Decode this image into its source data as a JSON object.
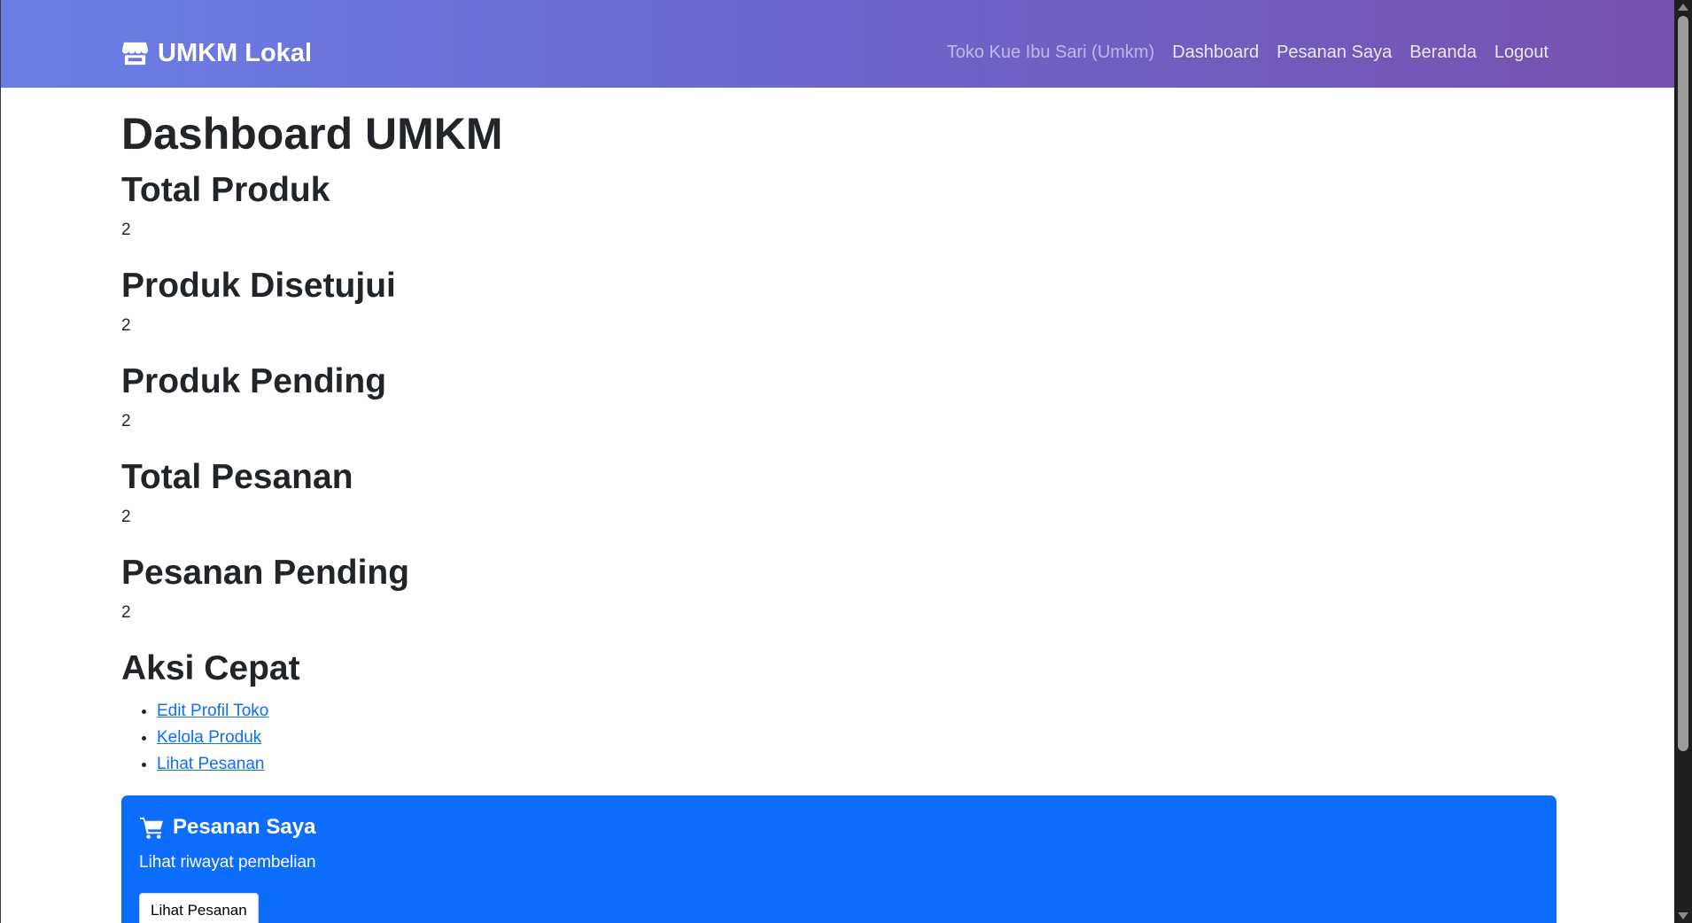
{
  "navbar": {
    "brand": "UMKM Lokal",
    "brand_icon": "store-icon",
    "user_label": "Toko Kue Ibu Sari (Umkm)",
    "links": [
      "Dashboard",
      "Pesanan Saya",
      "Beranda",
      "Logout"
    ],
    "gradient": [
      "#6a7fe6",
      "#7651ae"
    ]
  },
  "page": {
    "title": "Dashboard UMKM"
  },
  "stats": [
    {
      "label": "Total Produk",
      "value": "2"
    },
    {
      "label": "Produk Disetujui",
      "value": "2"
    },
    {
      "label": "Produk Pending",
      "value": "2"
    },
    {
      "label": "Total Pesanan",
      "value": "2"
    },
    {
      "label": "Pesanan Pending",
      "value": "2"
    }
  ],
  "quick_actions": {
    "title": "Aksi Cepat",
    "items": [
      "Edit Profil Toko",
      "Kelola Produk",
      "Lihat Pesanan"
    ]
  },
  "orders_card": {
    "icon": "cart-icon",
    "title": "Pesanan Saya",
    "text": "Lihat riwayat pembelian",
    "button": "Lihat Pesanan",
    "color": "#0d6efd"
  }
}
